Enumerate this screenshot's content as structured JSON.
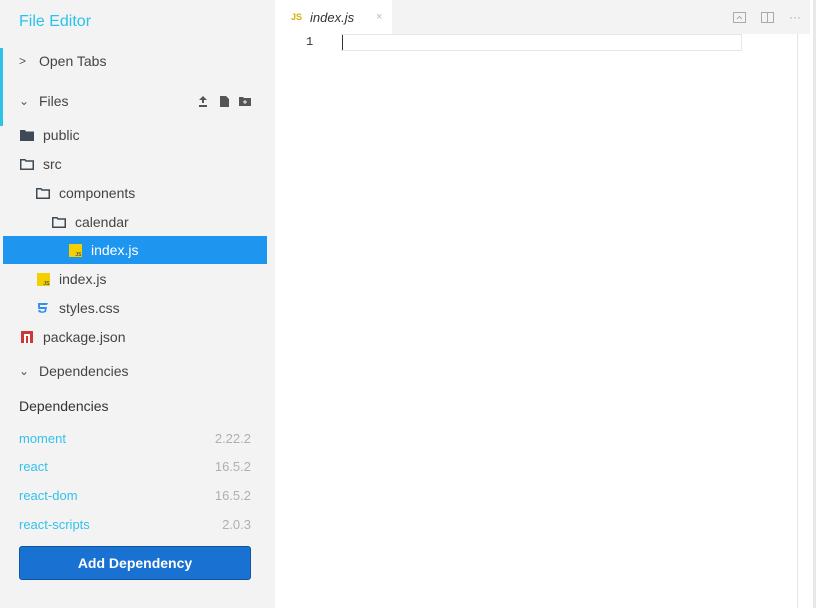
{
  "sidebar": {
    "title": "File Editor",
    "open_tabs_label": "Open Tabs",
    "files_label": "Files",
    "dependencies_section_label": "Dependencies"
  },
  "tree": [
    {
      "label": "public",
      "icon": "folder-filled-icon"
    },
    {
      "label": "src",
      "icon": "folder-open-icon"
    },
    {
      "label": "components",
      "icon": "folder-open-icon"
    },
    {
      "label": "calendar",
      "icon": "folder-open-icon"
    },
    {
      "label": "index.js",
      "icon": "js-file-icon",
      "selected": true
    },
    {
      "label": "index.js",
      "icon": "js-file-icon"
    },
    {
      "label": "styles.css",
      "icon": "css-file-icon"
    },
    {
      "label": "package.json",
      "icon": "npm-icon"
    }
  ],
  "dependencies": {
    "heading": "Dependencies",
    "items": [
      {
        "name": "moment",
        "version": "2.22.2"
      },
      {
        "name": "react",
        "version": "16.5.2"
      },
      {
        "name": "react-dom",
        "version": "16.5.2"
      },
      {
        "name": "react-scripts",
        "version": "2.0.3"
      }
    ],
    "add_button_label": "Add Dependency"
  },
  "editor": {
    "tab": {
      "badge": "JS",
      "name": "index.js",
      "close": "×"
    },
    "line_numbers": [
      "1"
    ]
  },
  "colors": {
    "accent": "#29c3ec",
    "selected_row": "#1e96ef",
    "button": "#1972d2",
    "sidebar_bg": "#f3f3f3"
  }
}
